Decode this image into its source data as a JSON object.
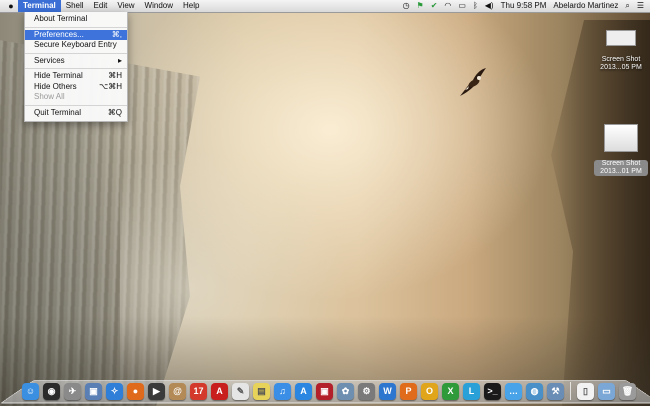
{
  "menubar": {
    "apple_icon": "apple-logo-icon",
    "app_name": "Terminal",
    "menus": [
      "Shell",
      "Edit",
      "View",
      "Window",
      "Help"
    ],
    "clock": "Thu 9:58 PM",
    "user": "Abelardo Martinez",
    "status_icons": [
      "clock-icon",
      "flag-icon",
      "check-icon",
      "wifi-icon",
      "battery-icon",
      "bluetooth-icon",
      "volume-icon",
      "spotlight-icon",
      "list-icon"
    ]
  },
  "app_menu": {
    "items": [
      {
        "label": "About Terminal",
        "shortcut": ""
      },
      {
        "label": "Preferences...",
        "shortcut": "⌘,"
      },
      {
        "label": "Secure Keyboard Entry",
        "shortcut": ""
      },
      {
        "label": "Services",
        "shortcut": "▸"
      },
      {
        "label": "Hide Terminal",
        "shortcut": "⌘H"
      },
      {
        "label": "Hide Others",
        "shortcut": "⌥⌘H"
      },
      {
        "label": "Show All",
        "shortcut": ""
      },
      {
        "label": "Quit Terminal",
        "shortcut": "⌘Q"
      }
    ]
  },
  "desktop_files": [
    {
      "label_line1": "Screen Shot",
      "label_line2": "2013...05 PM"
    },
    {
      "label_line1": "Screen Shot",
      "label_line2": "2013...01 PM"
    }
  ],
  "dock": {
    "apps": [
      {
        "name": "finder-icon",
        "glyph": "☺",
        "color": "#3b8fe0"
      },
      {
        "name": "dashboard-icon",
        "glyph": "◉",
        "color": "#2b2b2b"
      },
      {
        "name": "launchpad-icon",
        "glyph": "✈",
        "color": "#8a8a8a"
      },
      {
        "name": "photo-preview-icon",
        "glyph": "▣",
        "color": "#5a7fb5"
      },
      {
        "name": "safari-icon",
        "glyph": "✧",
        "color": "#2f7fd8"
      },
      {
        "name": "firefox-icon",
        "glyph": "●",
        "color": "#e06a1b"
      },
      {
        "name": "facetime-icon",
        "glyph": "▶",
        "color": "#3a3a3a"
      },
      {
        "name": "contacts-icon",
        "glyph": "@",
        "color": "#b38a55"
      },
      {
        "name": "calendar-icon",
        "glyph": "17",
        "color": "#d33a2c"
      },
      {
        "name": "acrobat-icon",
        "glyph": "A",
        "color": "#c81e1e"
      },
      {
        "name": "textedit-icon",
        "glyph": "✎",
        "color": "#e5e5e5"
      },
      {
        "name": "stickies-icon",
        "glyph": "▤",
        "color": "#e8d35a"
      },
      {
        "name": "itunes-icon",
        "glyph": "♫",
        "color": "#3a8ee6"
      },
      {
        "name": "app-store-icon",
        "glyph": "A",
        "color": "#2a86e0"
      },
      {
        "name": "photo-booth-icon",
        "glyph": "▣",
        "color": "#b3202a"
      },
      {
        "name": "iphoto-icon",
        "glyph": "✿",
        "color": "#6f8fb0"
      },
      {
        "name": "system-preferences-icon",
        "glyph": "⚙",
        "color": "#7a7a7a"
      },
      {
        "name": "word-icon",
        "glyph": "W",
        "color": "#2c76cf"
      },
      {
        "name": "powerpoint-icon",
        "glyph": "P",
        "color": "#e06b1a"
      },
      {
        "name": "outlook-icon",
        "glyph": "O",
        "color": "#e0a51a"
      },
      {
        "name": "excel-icon",
        "glyph": "X",
        "color": "#2f9a3a"
      },
      {
        "name": "lync-icon",
        "glyph": "L",
        "color": "#2aa0d8"
      },
      {
        "name": "terminal-icon",
        "glyph": ">_",
        "color": "#1a1a1a"
      },
      {
        "name": "messages-icon",
        "glyph": "…",
        "color": "#49a3e8"
      },
      {
        "name": "network-icon",
        "glyph": "◍",
        "color": "#4a90c8"
      },
      {
        "name": "xcode-icon",
        "glyph": "⚒",
        "color": "#6a8db5"
      }
    ],
    "right": [
      {
        "name": "document-icon",
        "glyph": "▯",
        "color": "#f2f2f2"
      },
      {
        "name": "folder-icon",
        "glyph": "▭",
        "color": "#7aa7d6"
      },
      {
        "name": "trash-icon",
        "glyph": "🗑",
        "color": "#9a9a9a"
      }
    ]
  }
}
